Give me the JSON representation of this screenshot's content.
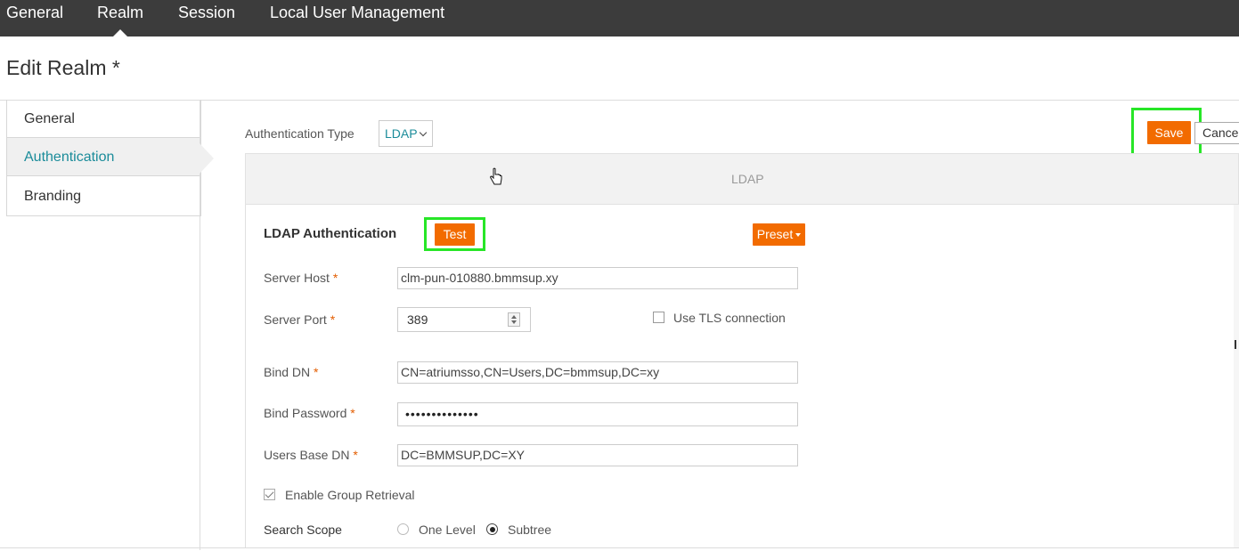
{
  "topnav": {
    "tabs": [
      {
        "label": "General"
      },
      {
        "label": "Realm"
      },
      {
        "label": "Session"
      },
      {
        "label": "Local User Management"
      }
    ],
    "active": "Realm"
  },
  "page": {
    "title": "Edit Realm *"
  },
  "sidebar": {
    "items": [
      {
        "label": "General"
      },
      {
        "label": "Authentication"
      },
      {
        "label": "Branding"
      }
    ],
    "active": "Authentication"
  },
  "toolbar": {
    "auth_type_label": "Authentication Type",
    "auth_type_value": "LDAP",
    "save_label": "Save",
    "cancel_label": "Cancel"
  },
  "ldap": {
    "header": "LDAP",
    "section_title": "LDAP Authentication",
    "test_label": "Test",
    "preset_label": "Preset",
    "fields": {
      "server_host": {
        "label": "Server Host",
        "value": "clm-pun-010880.bmmsup.xy"
      },
      "server_port": {
        "label": "Server Port",
        "value": "389"
      },
      "use_tls": {
        "label": "Use TLS connection",
        "checked": false
      },
      "bind_dn": {
        "label": "Bind DN",
        "value": "CN=atriumsso,CN=Users,DC=bmmsup,DC=xy"
      },
      "bind_password": {
        "label": "Bind Password",
        "masked": "••••••••••••••"
      },
      "users_base_dn": {
        "label": "Users Base DN",
        "value": "DC=BMMSUP,DC=XY"
      },
      "enable_group_retrieval": {
        "label": "Enable Group Retrieval",
        "checked": true
      },
      "search_scope": {
        "label": "Search Scope",
        "options": [
          {
            "label": "One Level",
            "selected": false
          },
          {
            "label": "Subtree",
            "selected": true
          }
        ]
      }
    },
    "required_marker": "*"
  },
  "colors": {
    "topnav_bg": "#3c3c3c",
    "accent_teal": "#1b8c9a",
    "button_orange": "#f26b00",
    "highlight_green": "#27e627"
  }
}
